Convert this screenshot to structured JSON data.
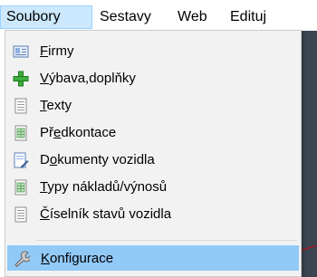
{
  "menubar": {
    "items": [
      {
        "label": "Soubory",
        "active": true
      },
      {
        "label": "Sestavy",
        "active": false
      },
      {
        "label": "Web",
        "active": false
      },
      {
        "label": "Edituj",
        "active": false
      }
    ]
  },
  "dropdown": {
    "items": [
      {
        "pre": "",
        "u": "F",
        "post": "irmy",
        "icon": "address-card-icon"
      },
      {
        "pre": "",
        "u": "V",
        "post": "ýbava,doplňky",
        "icon": "green-plus-icon"
      },
      {
        "pre": "",
        "u": "T",
        "post": "exty",
        "icon": "document-icon"
      },
      {
        "pre": "Př",
        "u": "e",
        "post": "dkontace",
        "icon": "document-table-icon"
      },
      {
        "pre": "D",
        "u": "o",
        "post": "kumenty vozidla",
        "icon": "document-edit-icon"
      },
      {
        "pre": "",
        "u": "T",
        "post": "ypy nákladů/výnosů",
        "icon": "document-table-icon"
      },
      {
        "pre": "",
        "u": "Č",
        "post": "íselník stavů vozidla",
        "icon": "document-icon"
      },
      {
        "pre": "",
        "u": "K",
        "post": "onfigurace",
        "icon": "wrench-icon",
        "highlighted": true
      }
    ]
  }
}
